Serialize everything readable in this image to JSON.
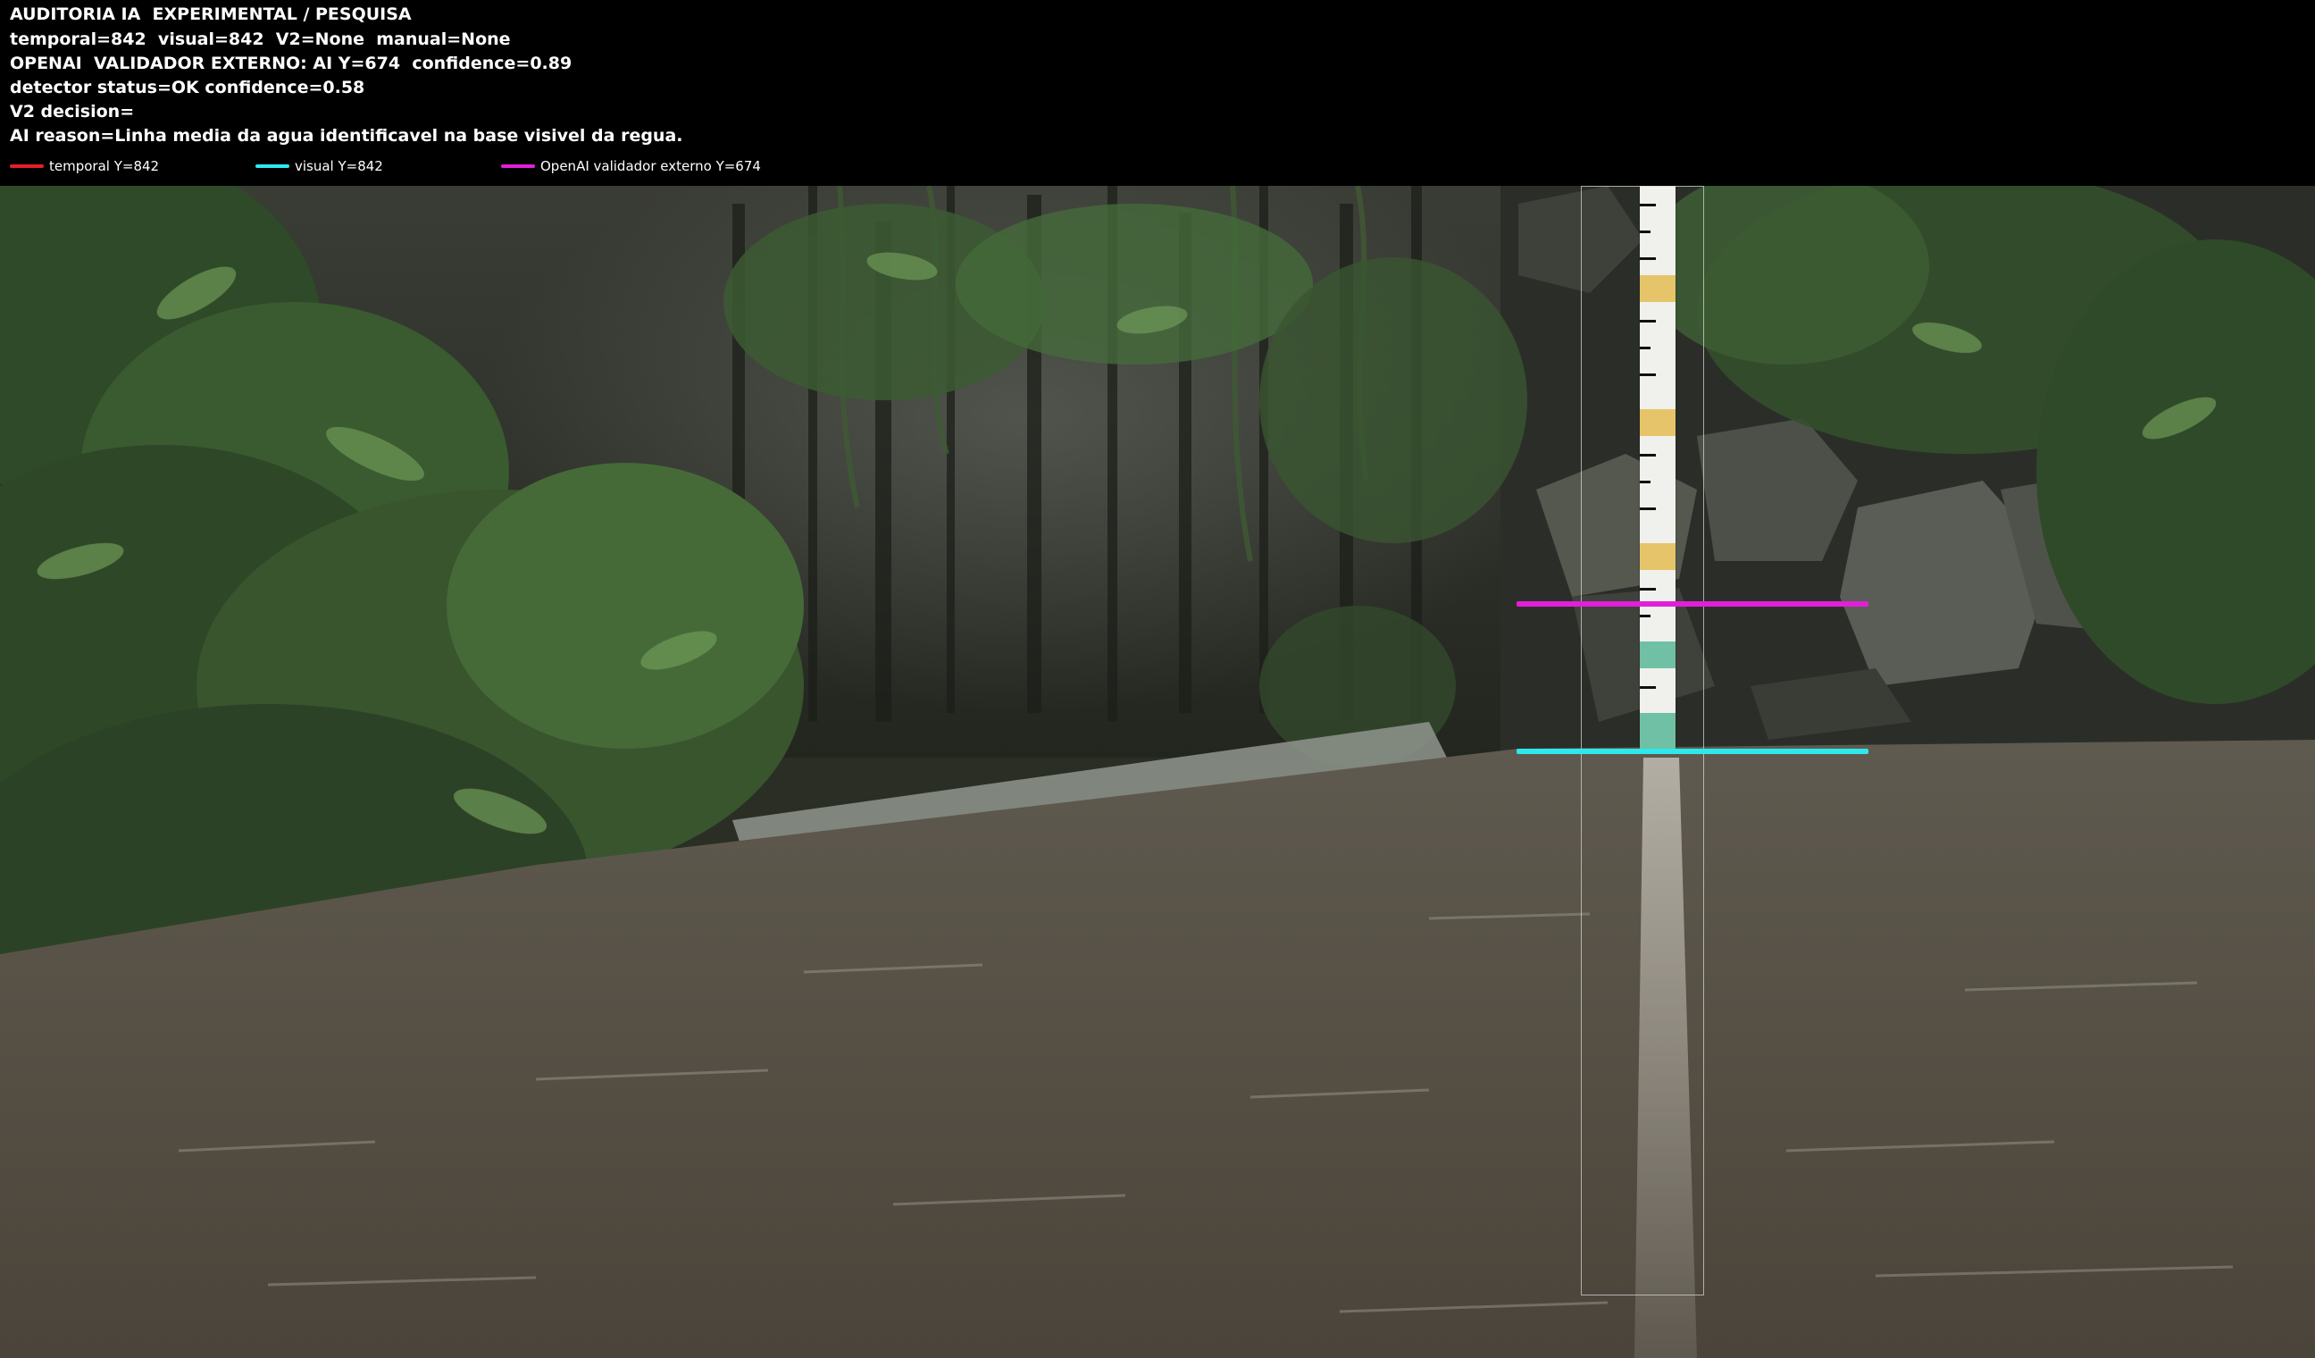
{
  "header": {
    "lines": [
      "AUDITORIA IA  EXPERIMENTAL / PESQUISA",
      "temporal=842  visual=842  V2=None  manual=None",
      "OPENAI  VALIDADOR EXTERNO: AI Y=674  confidence=0.89",
      "detector status=OK confidence=0.58",
      "V2 decision=",
      "AI reason=Linha media da agua identificavel na base visivel da regua."
    ]
  },
  "legend": [
    {
      "label": "temporal Y=842",
      "color": "#e0202a"
    },
    {
      "label": "visual Y=842",
      "color": "#2ee8ee"
    },
    {
      "label": "OpenAI validador externo Y=674",
      "color": "#e020d8"
    }
  ],
  "overlay": {
    "roi_color": "#d2d7d2",
    "visual_line_color": "#2ee8ee",
    "openai_line_color": "#e020d8"
  },
  "icons": {
    "legend_swatch": "line-swatch"
  }
}
